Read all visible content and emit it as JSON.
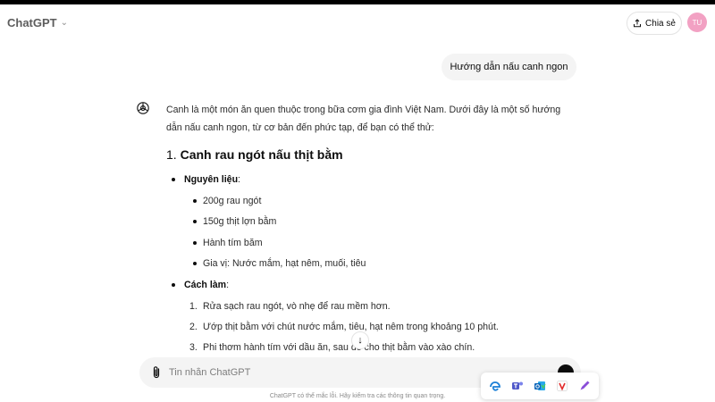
{
  "header": {
    "model_name": "ChatGPT",
    "share_label": "Chia sẻ",
    "avatar_initials": "TU"
  },
  "user_message": "Hướng dẫn nấu canh ngon",
  "answer": {
    "intro": "Canh là một món ăn quen thuộc trong bữa cơm gia đình Việt Nam. Dưới đây là một số hướng dẫn nấu canh ngon, từ cơ bản đến phức tạp, để bạn có thể thử:",
    "section_number": "1.",
    "section_title": "Canh rau ngót nấu thịt bằm",
    "ingredients_label": "Nguyên liệu",
    "ingredients": [
      "200g rau ngót",
      "150g thịt lợn bằm",
      "Hành tím băm",
      "Gia vị: Nước mắm, hạt nêm, muối, tiêu"
    ],
    "method_label": "Cách làm",
    "steps": [
      {
        "n": "1.",
        "text": "Rửa sạch rau ngót, vò nhẹ để rau mềm hơn."
      },
      {
        "n": "2.",
        "text": "Ướp thịt bằm với chút nước mắm, tiêu, hạt nêm trong khoảng 10 phút."
      },
      {
        "n": "3.",
        "text": "Phi thơm hành tím với dầu ăn, sau đó cho thịt bằm vào xào chín."
      }
    ]
  },
  "composer": {
    "placeholder": "Tin nhắn ChatGPT"
  },
  "disclaimer": "ChatGPT có thể mắc lỗi. Hãy kiểm tra các thông tin quan trọng.",
  "colors": {
    "accent_avatar": "#f2a1c3",
    "bubble_bg": "#f4f4f4"
  },
  "tray_icons": [
    "edge-icon",
    "teams-icon",
    "outlook-icon",
    "vivaldi-icon",
    "pen-icon"
  ]
}
